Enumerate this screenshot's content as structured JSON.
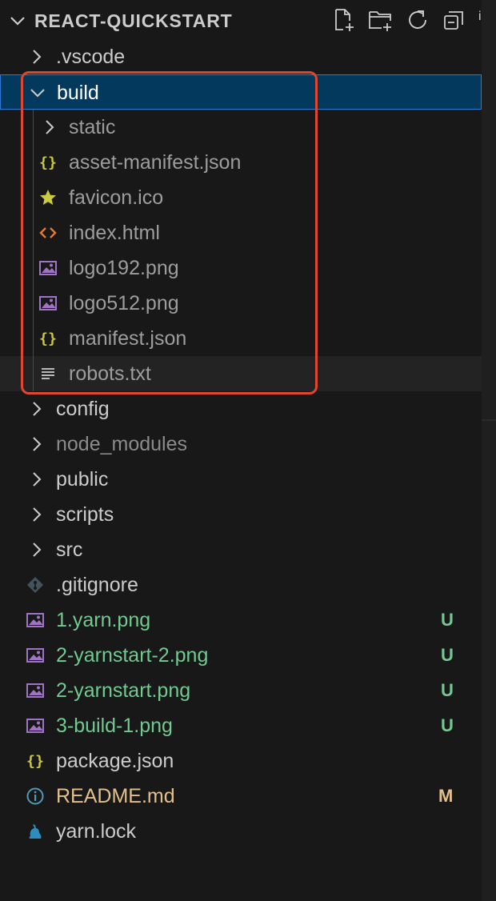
{
  "explorer": {
    "title": "REACT-QUICKSTART",
    "actions": [
      {
        "name": "new-file-button",
        "icon": "new-file-icon"
      },
      {
        "name": "new-folder-button",
        "icon": "new-folder-icon"
      },
      {
        "name": "refresh-button",
        "icon": "refresh-icon"
      },
      {
        "name": "collapse-all-button",
        "icon": "collapse-all-icon"
      }
    ],
    "overflow_badge_icon": "info-icon"
  },
  "tree": [
    {
      "label": ".vscode",
      "type": "folder",
      "expanded": false,
      "depth": 0
    },
    {
      "label": "build",
      "type": "folder",
      "expanded": true,
      "depth": 0,
      "selected": true
    },
    {
      "label": "static",
      "type": "folder",
      "expanded": false,
      "depth": 1
    },
    {
      "label": "asset-manifest.json",
      "type": "json",
      "depth": 1,
      "icon": "json-braces-icon"
    },
    {
      "label": "favicon.ico",
      "type": "favicon",
      "depth": 1,
      "icon": "star-icon"
    },
    {
      "label": "index.html",
      "type": "html",
      "depth": 1,
      "icon": "html-code-icon"
    },
    {
      "label": "logo192.png",
      "type": "image",
      "depth": 1,
      "icon": "image-icon"
    },
    {
      "label": "logo512.png",
      "type": "image",
      "depth": 1,
      "icon": "image-icon"
    },
    {
      "label": "manifest.json",
      "type": "json",
      "depth": 1,
      "icon": "json-braces-icon"
    },
    {
      "label": "robots.txt",
      "type": "text",
      "depth": 1,
      "icon": "text-lines-icon",
      "hover": true
    },
    {
      "label": "config",
      "type": "folder",
      "expanded": false,
      "depth": 0
    },
    {
      "label": "node_modules",
      "type": "folder",
      "expanded": false,
      "depth": 0
    },
    {
      "label": "public",
      "type": "folder",
      "expanded": false,
      "depth": 0
    },
    {
      "label": "scripts",
      "type": "folder",
      "expanded": false,
      "depth": 0
    },
    {
      "label": "src",
      "type": "folder",
      "expanded": false,
      "depth": 0
    },
    {
      "label": ".gitignore",
      "type": "git",
      "depth": 0,
      "icon": "git-diamond-icon"
    },
    {
      "label": "1.yarn.png",
      "type": "image",
      "depth": 0,
      "icon": "image-icon",
      "status": "U"
    },
    {
      "label": "2-yarnstart-2.png",
      "type": "image",
      "depth": 0,
      "icon": "image-icon",
      "status": "U"
    },
    {
      "label": "2-yarnstart.png",
      "type": "image",
      "depth": 0,
      "icon": "image-icon",
      "status": "U"
    },
    {
      "label": "3-build-1.png",
      "type": "image",
      "depth": 0,
      "icon": "image-icon",
      "status": "U"
    },
    {
      "label": "package.json",
      "type": "json",
      "depth": 0,
      "icon": "json-braces-icon"
    },
    {
      "label": "README.md",
      "type": "markdown",
      "depth": 0,
      "icon": "info-circle-icon",
      "status": "M"
    },
    {
      "label": "yarn.lock",
      "type": "yarn",
      "depth": 0,
      "icon": "yarn-cat-icon"
    }
  ],
  "colors": {
    "background": "#181818",
    "selected_row": "#04395e",
    "selected_border": "#2b79d0",
    "untracked": "#73c991",
    "modified": "#e2c08d",
    "annotation_box": "#e0452e",
    "json_icon": "#cbcb41",
    "html_icon": "#e37933",
    "image_icon": "#a074c4",
    "star_icon": "#cbcb41"
  }
}
